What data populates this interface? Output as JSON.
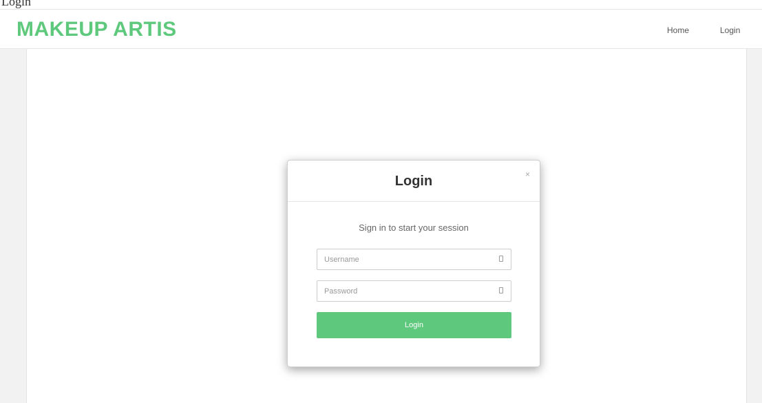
{
  "page_fragment": "Login",
  "navbar": {
    "brand": "MAKEUP ARTIS",
    "links": [
      {
        "label": "Home"
      },
      {
        "label": "Login"
      }
    ]
  },
  "login_modal": {
    "title": "Login",
    "close_symbol": "×",
    "subtitle": "Sign in to start your session",
    "username": {
      "placeholder": "Username",
      "value": "",
      "icon": "user-icon"
    },
    "password": {
      "placeholder": "Password",
      "value": "",
      "icon": "lock-icon"
    },
    "submit_label": "Login"
  },
  "colors": {
    "accent": "#5ec97c",
    "background": "#f2f2f2"
  }
}
